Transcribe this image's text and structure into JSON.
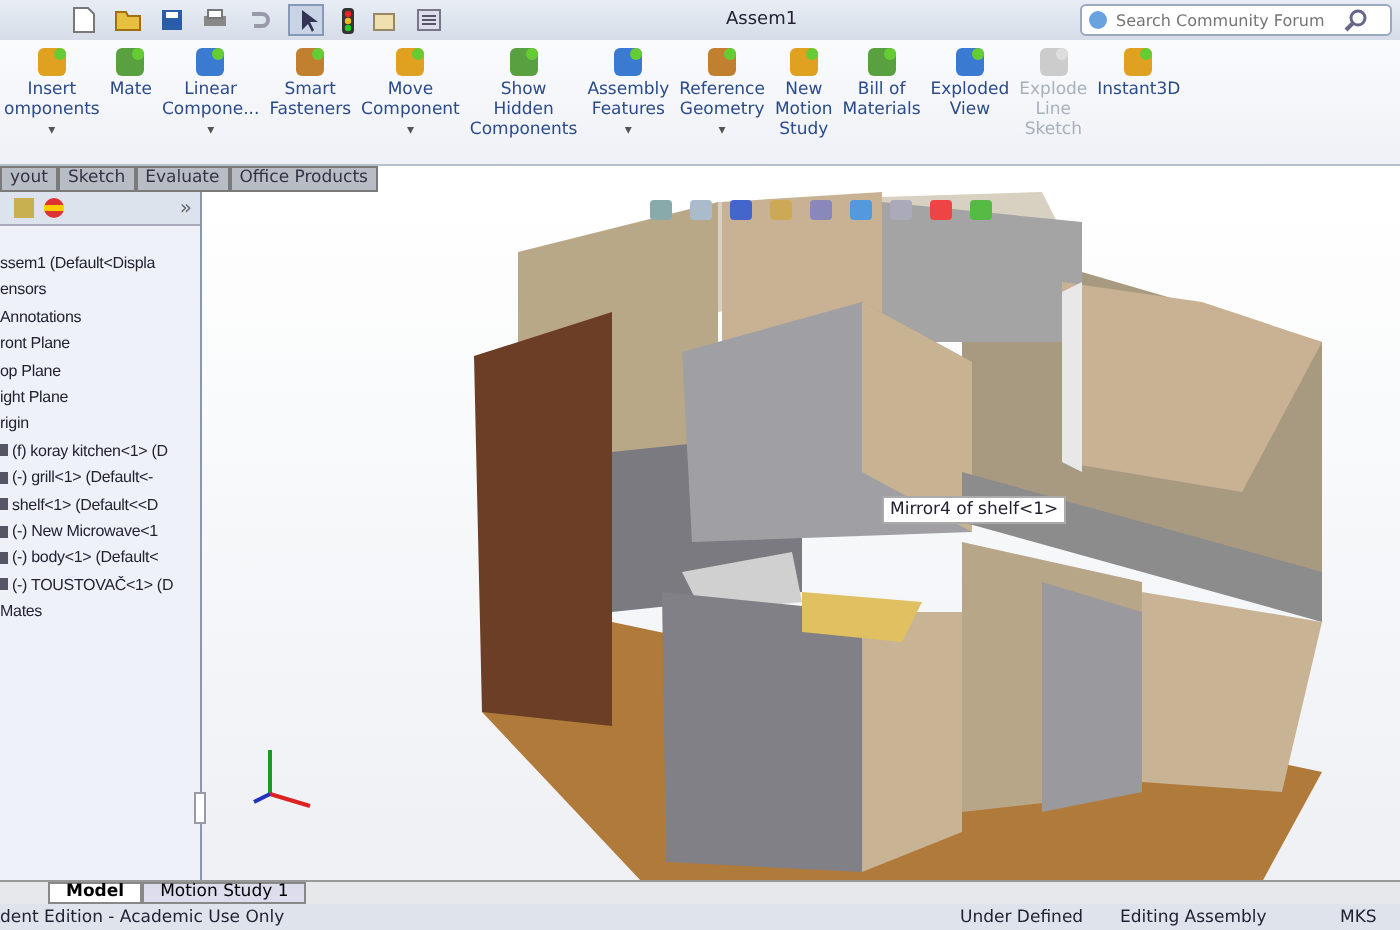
{
  "title_bar": {
    "title": "Assem1",
    "search": {
      "placeholder": "Search Community Forum"
    }
  },
  "ribbon": [
    {
      "label": "Insert\nomponents",
      "dropdown": true,
      "disabled": false
    },
    {
      "label": "Mate",
      "dropdown": false,
      "disabled": false
    },
    {
      "label": "Linear\nCompone...",
      "dropdown": true,
      "disabled": false
    },
    {
      "label": "Smart\nFasteners",
      "dropdown": false,
      "disabled": false
    },
    {
      "label": "Move\nComponent",
      "dropdown": true,
      "disabled": false
    },
    {
      "label": "Show\nHidden\nComponents",
      "dropdown": false,
      "disabled": false
    },
    {
      "label": "Assembly\nFeatures",
      "dropdown": true,
      "disabled": false
    },
    {
      "label": "Reference\nGeometry",
      "dropdown": true,
      "disabled": false
    },
    {
      "label": "New\nMotion\nStudy",
      "dropdown": false,
      "disabled": false
    },
    {
      "label": "Bill of\nMaterials",
      "dropdown": false,
      "disabled": false
    },
    {
      "label": "Exploded\nView",
      "dropdown": false,
      "disabled": false
    },
    {
      "label": "Explode\nLine\nSketch",
      "dropdown": false,
      "disabled": true
    },
    {
      "label": "Instant3D",
      "dropdown": false,
      "disabled": false
    }
  ],
  "tabs": [
    {
      "label": "yout",
      "selected": false
    },
    {
      "label": "Sketch",
      "selected": false
    },
    {
      "label": "Evaluate",
      "selected": false
    },
    {
      "label": "Office Products",
      "selected": false
    }
  ],
  "tree": [
    {
      "label": "ssem1  (Default<Displa",
      "kind": "plain"
    },
    {
      "label": "ensors",
      "kind": "plain"
    },
    {
      "label": "Annotations",
      "kind": "plain"
    },
    {
      "label": "ront Plane",
      "kind": "plain"
    },
    {
      "label": "op Plane",
      "kind": "plain"
    },
    {
      "label": "ight Plane",
      "kind": "plain"
    },
    {
      "label": "rigin",
      "kind": "plain"
    },
    {
      "label": "(f) koray kitchen<1> (D",
      "kind": "component"
    },
    {
      "label": "(-) grill<1> (Default<-",
      "kind": "component"
    },
    {
      "label": "shelf<1> (Default<<D",
      "kind": "component"
    },
    {
      "label": "(-) New Microwave<1",
      "kind": "component"
    },
    {
      "label": "(-) body<1> (Default<",
      "kind": "component"
    },
    {
      "label": "(-) TOUSTOVAČ<1> (D",
      "kind": "component"
    },
    {
      "label": "Mates",
      "kind": "plain"
    }
  ],
  "panel_expand": "»",
  "dropdown_glyph": "▾",
  "tooltip": "Mirror4 of shelf<1>",
  "bottom_tabs": [
    {
      "label": "Model",
      "selected": true
    },
    {
      "label": "Motion Study 1",
      "selected": false
    }
  ],
  "status_bar": [
    "dent Edition - Academic Use Only",
    "Under Defined",
    "Editing Assembly",
    "MKS"
  ]
}
